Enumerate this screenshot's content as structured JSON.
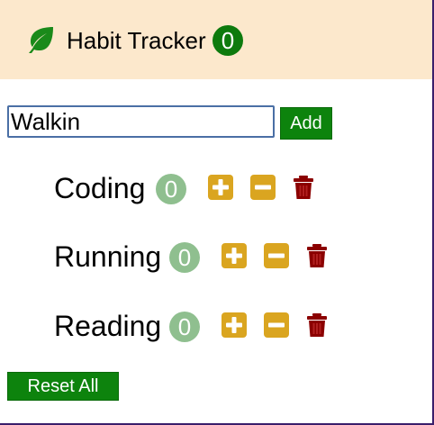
{
  "header": {
    "title": "Habit Tracker",
    "total_count": "0"
  },
  "form": {
    "input_value": "Walkin",
    "add_label": "Add"
  },
  "habits": [
    {
      "name": "Coding",
      "count": "0"
    },
    {
      "name": "Running",
      "count": "0"
    },
    {
      "name": "Reading",
      "count": "0"
    }
  ],
  "footer": {
    "reset_label": "Reset All"
  },
  "colors": {
    "header_bg": "#fce8cc",
    "brand_green": "#0d7a0d",
    "count_badge": "#8fbf8f",
    "increment_yellow": "#daa520",
    "delete_red": "#8b0000"
  },
  "icons": {
    "logo": "leaf-icon",
    "increment": "plus-square-icon",
    "decrement": "minus-square-icon",
    "delete": "trash-icon"
  }
}
